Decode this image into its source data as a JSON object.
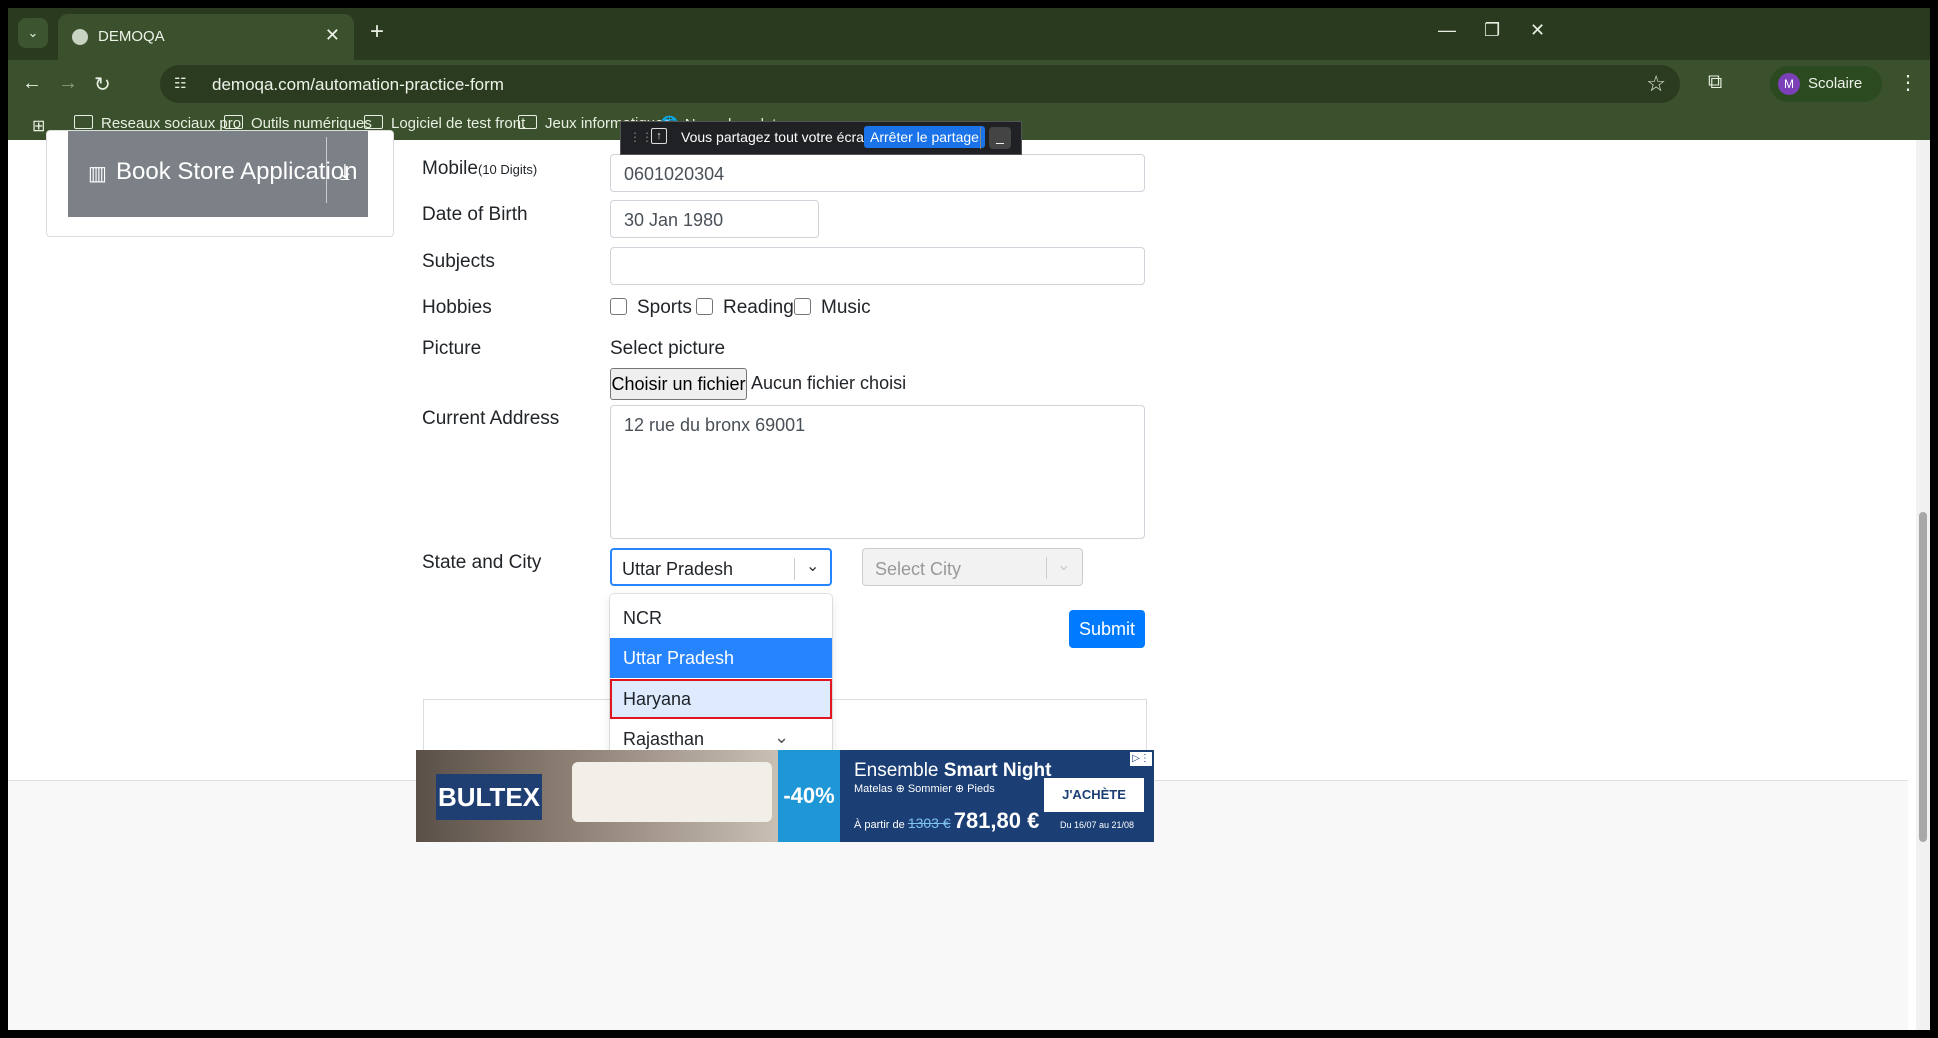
{
  "browser": {
    "tab_title": "DEMOQA",
    "url": "demoqa.com/automation-practice-form",
    "profile_initial": "M",
    "profile_name": "Scolaire",
    "bookmarks": [
      "Reseaux sociaux pro",
      "Outils numériques",
      "Logiciel de test front",
      "Jeux informatiques",
      "Nouvel onglet"
    ]
  },
  "share_bar": {
    "message": "Vous partagez tout votre écran.",
    "stop_label": "Arrêter le partage"
  },
  "sidebar": {
    "book_store_label": "Book Store Application"
  },
  "form": {
    "mobile_label": "Mobile",
    "mobile_hint": "(10 Digits)",
    "mobile_value": "0601020304",
    "dob_label": "Date of Birth",
    "dob_value": "30 Jan 1980",
    "subjects_label": "Subjects",
    "subjects_value": "",
    "hobbies_label": "Hobbies",
    "hobbies": [
      "Sports",
      "Reading",
      "Music"
    ],
    "picture_label": "Picture",
    "picture_prompt": "Select picture",
    "file_button": "Choisir un fichier",
    "file_status": "Aucun fichier choisi",
    "address_label": "Current Address",
    "address_value": "12 rue du bronx 69001",
    "state_city_label": "State and City",
    "state_value": "Uttar Pradesh",
    "city_placeholder": "Select City",
    "submit_label": "Submit",
    "state_options": [
      "NCR",
      "Uttar Pradesh",
      "Haryana",
      "Rajasthan"
    ],
    "selected_state_index": 1,
    "hovered_state_index": 2
  },
  "ad": {
    "brand": "BULTEX",
    "discount": "-40%",
    "headline_prefix": "Ensemble ",
    "headline_bold": "Smart Night",
    "products": "Matelas ⊕ Sommier ⊕ Pieds",
    "from_label": "À partir de",
    "old_price": "1303 €",
    "new_price": "781,80 €",
    "cta": "J'ACHÈTE",
    "dates": "Du 16/07 au 21/08"
  },
  "colors": {
    "chrome_bg": "#3b512d",
    "primary": "#007bff",
    "selected_option": "#2684ff",
    "hover_option": "#deebff",
    "highlight_border": "#e0151d"
  }
}
